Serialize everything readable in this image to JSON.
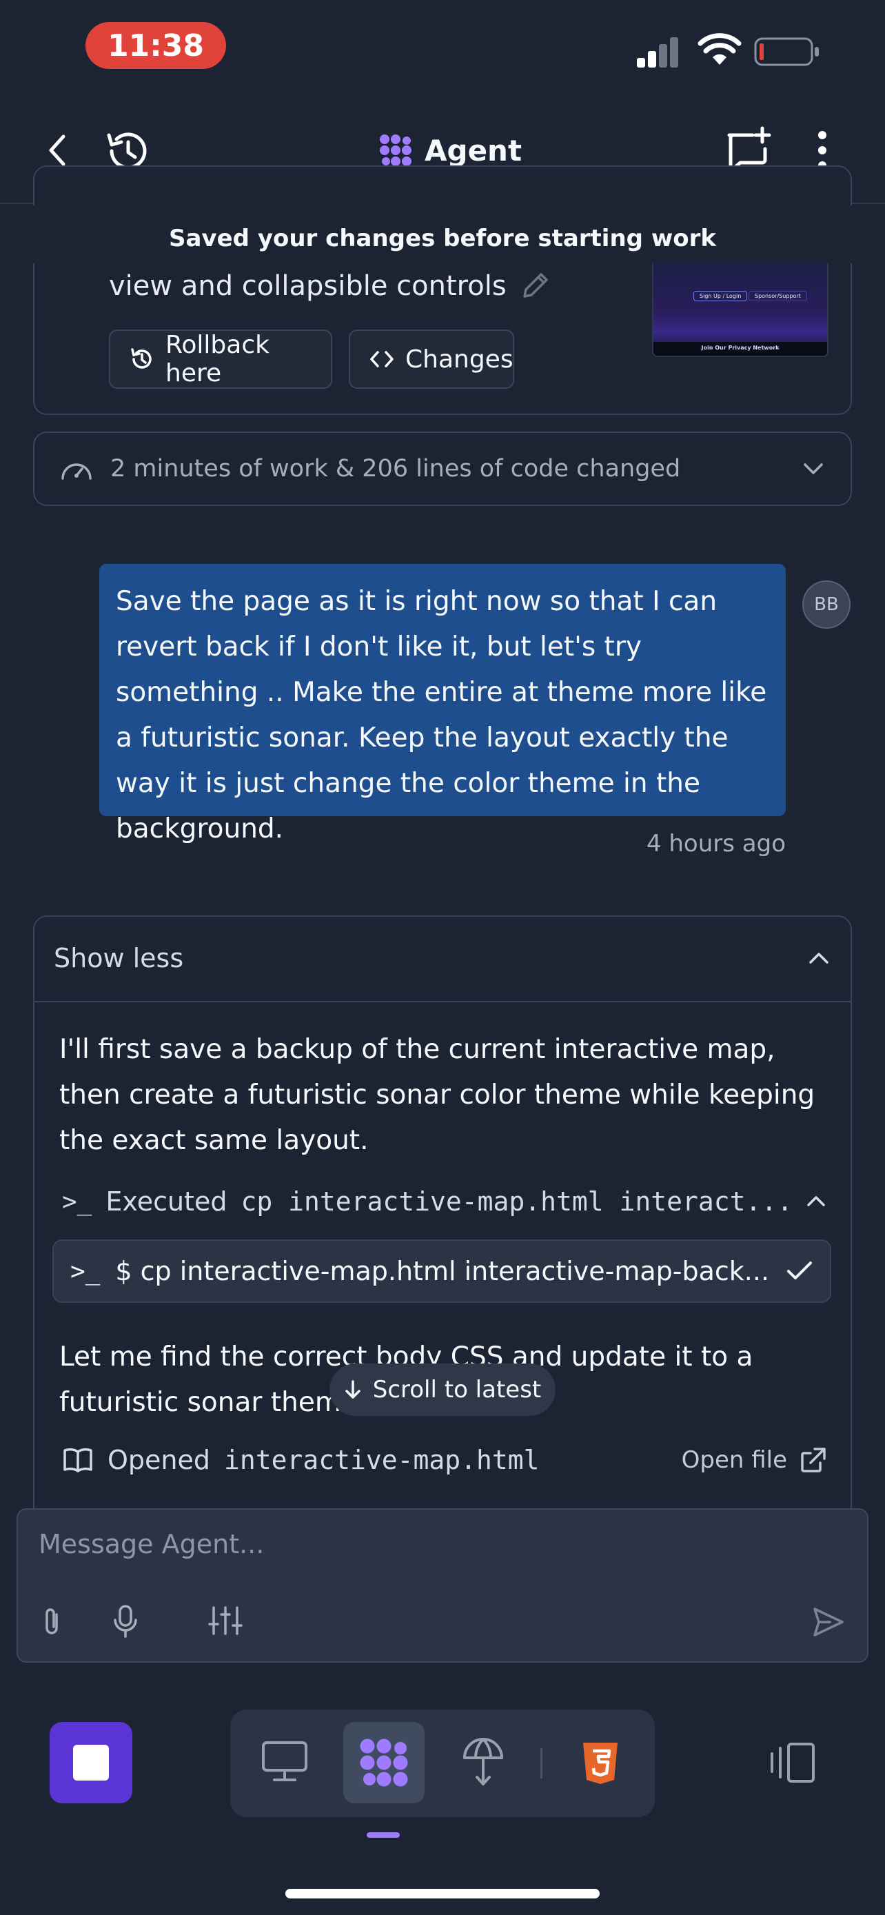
{
  "status_bar": {
    "time": "11:38"
  },
  "header": {
    "title": "Agent"
  },
  "banner": "Saved your changes before starting work",
  "checkpoint": {
    "partial_text": "view and collapsible controls",
    "rollback_label": "Rollback here",
    "changes_label": "Changes",
    "thumb_text_1": "Sign Up / Login",
    "thumb_text_2": "Sponsor/Support",
    "thumb_text_3": "Join Our Privacy Network"
  },
  "work_summary": "2 minutes of work & 206 lines of code changed",
  "user_message": {
    "text": "Save the page as it is right now so that I can revert back if I don't like it, but let's try something .. Make the entire at theme more like a futuristic sonar. Keep the layout exactly the way it is just change the color theme in the background.",
    "avatar": "BB",
    "time": "4 hours ago"
  },
  "agent_response": {
    "toggle_label": "Show less",
    "intro": "I'll first save a backup of the current interactive map, then create a futuristic sonar color theme while keeping the exact same layout.",
    "executed_label": "Executed",
    "executed_cmd": "cp interactive-map.html interact...",
    "command": "$ cp interactive-map.html interactive-map-back...",
    "followup": "Let me find the correct body CSS and update it to a futuristic sonar theme:",
    "opened_label": "Opened",
    "opened_file": "interactive-map.html",
    "open_file_label": "Open file"
  },
  "scroll_latest": "Scroll to latest",
  "composer": {
    "placeholder": "Message Agent..."
  },
  "colors": {
    "accent": "#5b34d6",
    "user_bubble": "#1f4e8f",
    "background": "#1c2333",
    "status_pill": "#e1423a",
    "html5": "#e7672a"
  }
}
